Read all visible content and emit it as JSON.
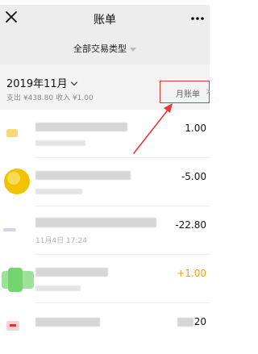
{
  "nav": {
    "title": "账单"
  },
  "filter": {
    "label": "全部交易类型"
  },
  "month": {
    "label": "2019年11月",
    "expense": "支出 ¥438.80",
    "income": "收入 ¥1.00",
    "bill_link": "月账单"
  },
  "transactions": [
    {
      "amount": "1.00",
      "time": "",
      "type": "expense"
    },
    {
      "amount": "-5.00",
      "time": "",
      "type": "expense"
    },
    {
      "amount": "-22.80",
      "time": "11月4日 17:24",
      "type": "expense"
    },
    {
      "amount": "+1.00",
      "time": "",
      "type": "income"
    },
    {
      "amount": "20",
      "time": "",
      "type": "expense"
    }
  ],
  "colors": {
    "accent_red": "#e53935",
    "income_orange": "#f2a01c",
    "nav_bg": "#ededed"
  },
  "icons": {
    "close": "close-icon",
    "more": "more-icon",
    "arrow": "pointer-arrow"
  }
}
